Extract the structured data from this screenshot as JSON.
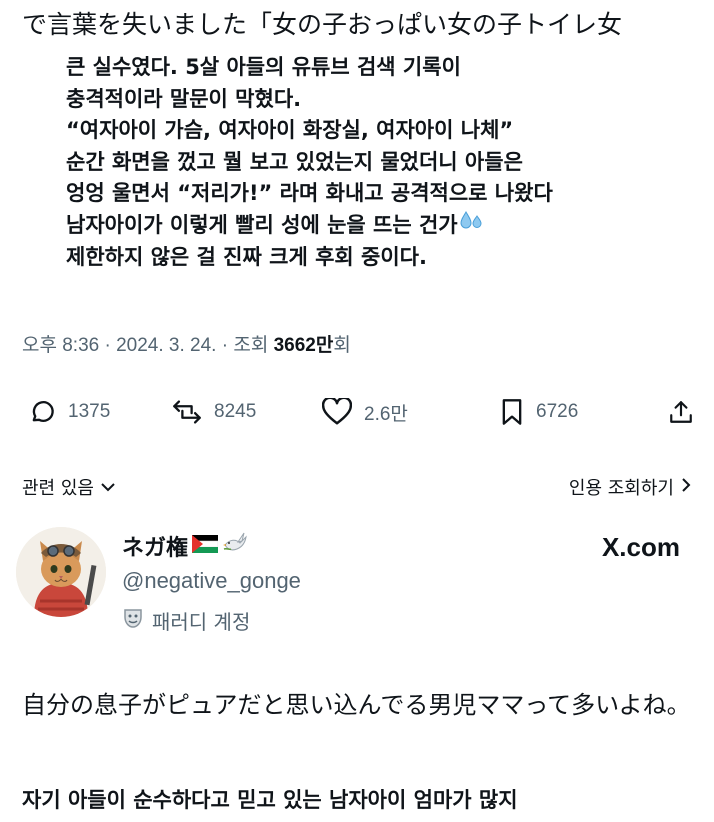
{
  "header_cut_text": "で言葉を失いました「女の子おっぱい女の子トイレ女",
  "translation_lines": [
    "큰 실수였다. 5살 아들의 유튜브 검색 기록이",
    "충격적이라 말문이 막혔다.",
    "“여자아이 가슴, 여자아이 화장실, 여자아이 나체”",
    "순간 화면을 껐고 뭘 보고 있었는지 물었더니 아들은",
    "엉엉 울면서 “저리가!” 라며 화내고 공격적으로 나왔다",
    "남자아이가 이렇게 빨리 성에 눈을 뜨는 건가",
    "제한하지 않은 걸 진짜 크게 후회 중이다."
  ],
  "meta": {
    "time": "오후 8:36 · 2024. 3. 24. · 조회 ",
    "views": "3662만",
    "views_suffix": "회"
  },
  "actions": {
    "replies": "1375",
    "retweets": "8245",
    "likes": "2.6만",
    "bookmarks": "6726"
  },
  "related": {
    "label": "관련 있음",
    "quotes_label": "인용 조회하기"
  },
  "quoted_user": {
    "display_name": "ネガ権",
    "handle": "@negative_gonge",
    "parody_label": "패러디 계정",
    "watermark": "X.com"
  },
  "quoted_text": "自分の息子がピュアだと思い込んでる男児ママって多いよね。",
  "quoted_translation": "자기 아들이 순수하다고 믿고 있는 남자아이 엄마가 많지",
  "colors": {
    "text": "#0f1419",
    "secondary": "#536471"
  }
}
